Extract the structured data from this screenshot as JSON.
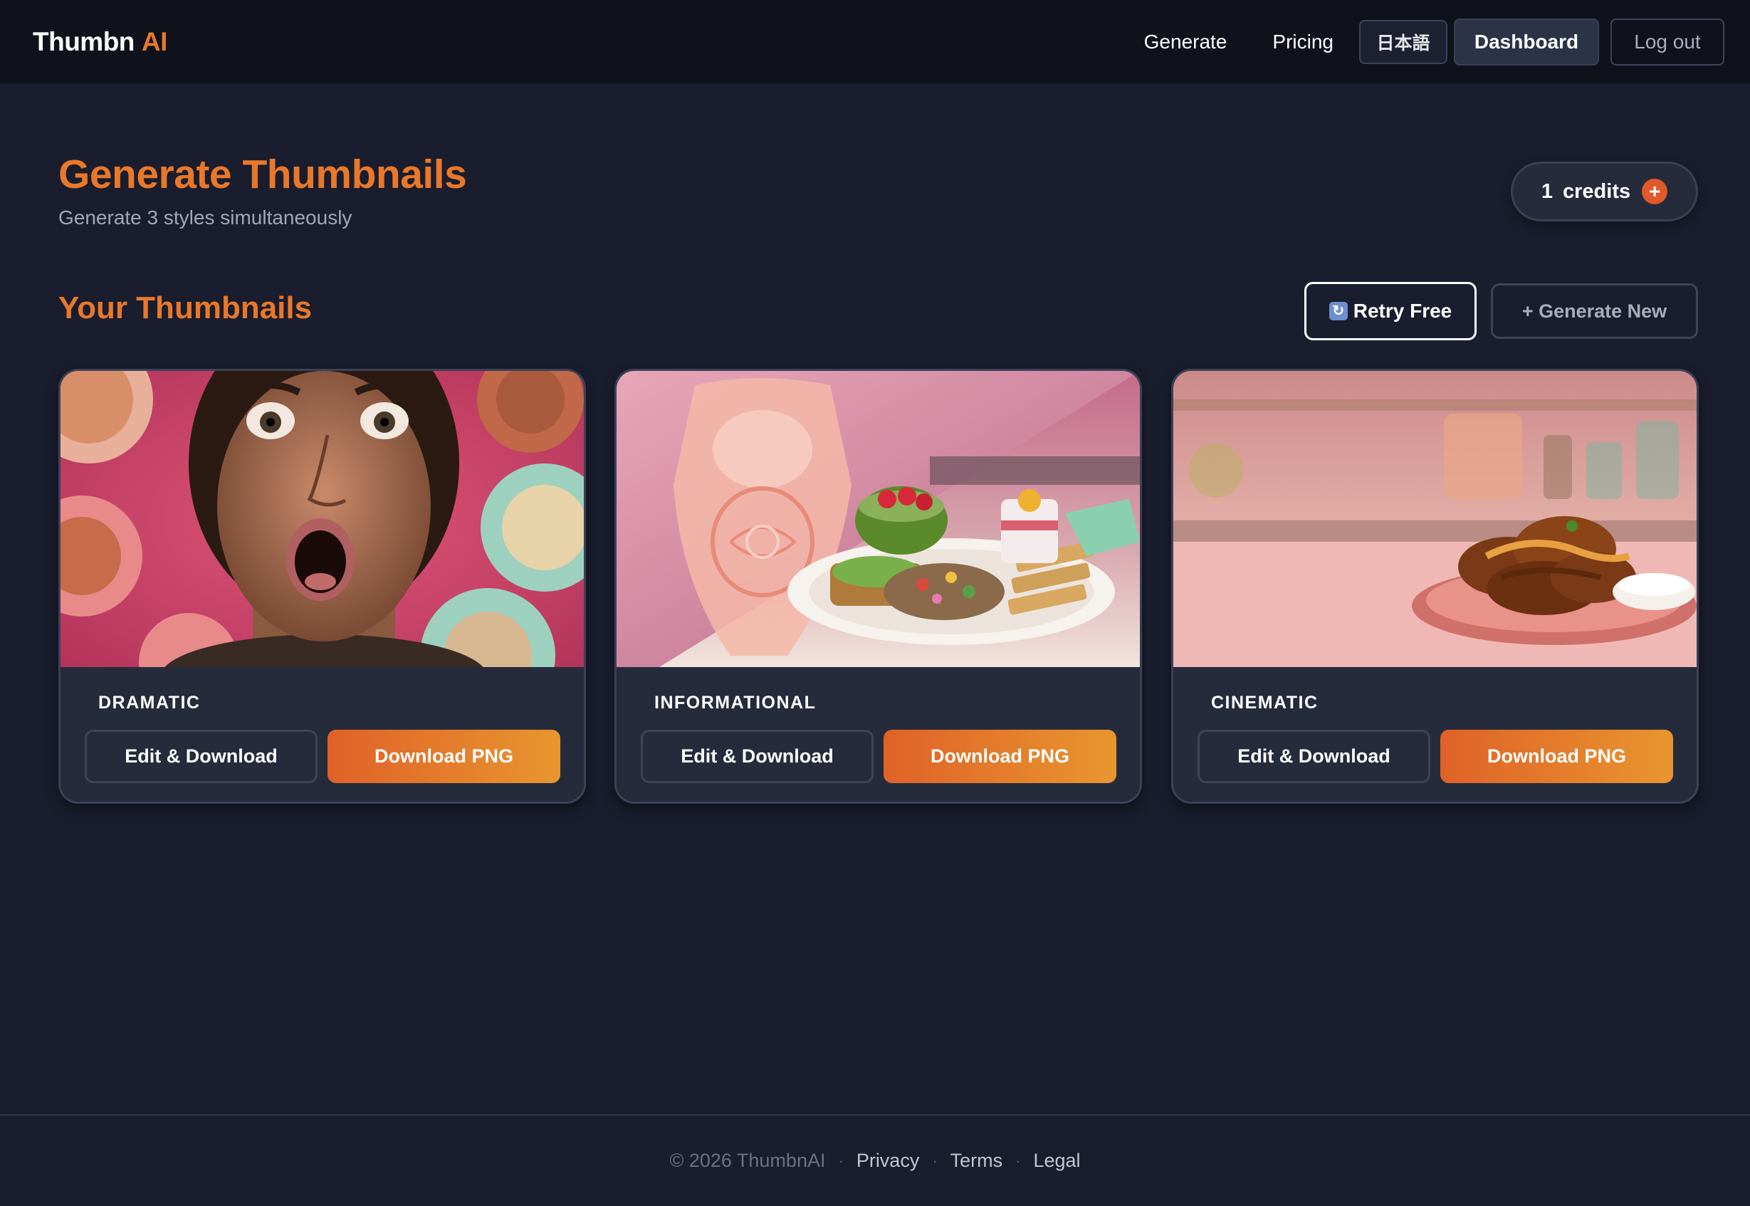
{
  "nav": {
    "logo_main": "Thumbn",
    "logo_accent": "AI",
    "links": [
      "Generate",
      "Pricing"
    ],
    "lang_label": "日本語",
    "dashboard_label": "Dashboard",
    "logout_label": "Log out"
  },
  "header": {
    "title": "Generate Thumbnails",
    "subtitle": "Generate 3 styles simultaneously",
    "credits_count": "1",
    "credits_label": "credits",
    "credits_plus": "+"
  },
  "section": {
    "title": "Your Thumbnails",
    "retry_label": "Retry Free",
    "generate_new_label": "+ Generate New"
  },
  "cards": [
    {
      "style": "DRAMATIC",
      "edit_label": "Edit & Download",
      "download_label": "Download PNG",
      "image_icon": "shocked-woman-food-image"
    },
    {
      "style": "INFORMATIONAL",
      "edit_label": "Edit & Download",
      "download_label": "Download PNG",
      "image_icon": "anatomy-healthy-meal-image"
    },
    {
      "style": "CINEMATIC",
      "edit_label": "Edit & Download",
      "download_label": "Download PNG",
      "image_icon": "fried-chicken-kitchen-image"
    }
  ],
  "footer": {
    "copyright": "© 2026 ThumbnAI",
    "separator": "·",
    "links": [
      "Privacy",
      "Terms",
      "Legal"
    ]
  },
  "colors": {
    "background": "#1a1d2d",
    "navbar": "#0f111b",
    "accent": "#e8782a",
    "card": "#262b3b",
    "download_gradient_start": "#df6228",
    "download_gradient_end": "#e8962f"
  }
}
